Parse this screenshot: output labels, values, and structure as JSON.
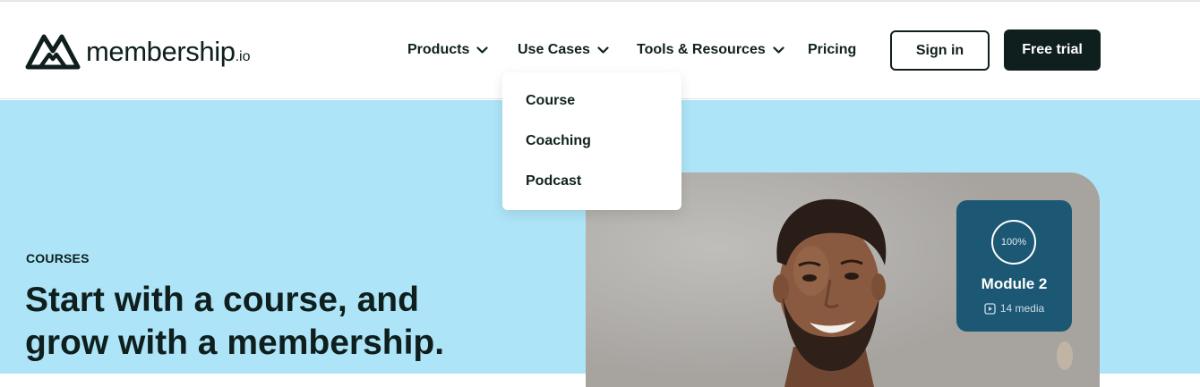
{
  "header": {
    "logo": {
      "wordmark": "membership",
      "suffix": ".io"
    },
    "nav": [
      {
        "label": "Products",
        "has_dropdown": true
      },
      {
        "label": "Use Cases",
        "has_dropdown": true
      },
      {
        "label": "Tools & Resources",
        "has_dropdown": true
      },
      {
        "label": "Pricing",
        "has_dropdown": false
      }
    ],
    "sign_in_label": "Sign in",
    "free_trial_label": "Free trial"
  },
  "use_cases_menu": {
    "items": [
      "Course",
      "Coaching",
      "Podcast"
    ]
  },
  "hero": {
    "eyebrow": "COURSES",
    "headline_line1": "Start with a course, and",
    "headline_line2": "grow with a membership."
  },
  "module_card": {
    "progress": "100%",
    "title": "Module 2",
    "media_count": "14 media"
  },
  "colors": {
    "hero_background": "#ade4f7",
    "primary_dark": "#0f1f1e",
    "module_card": "#1c5874"
  }
}
